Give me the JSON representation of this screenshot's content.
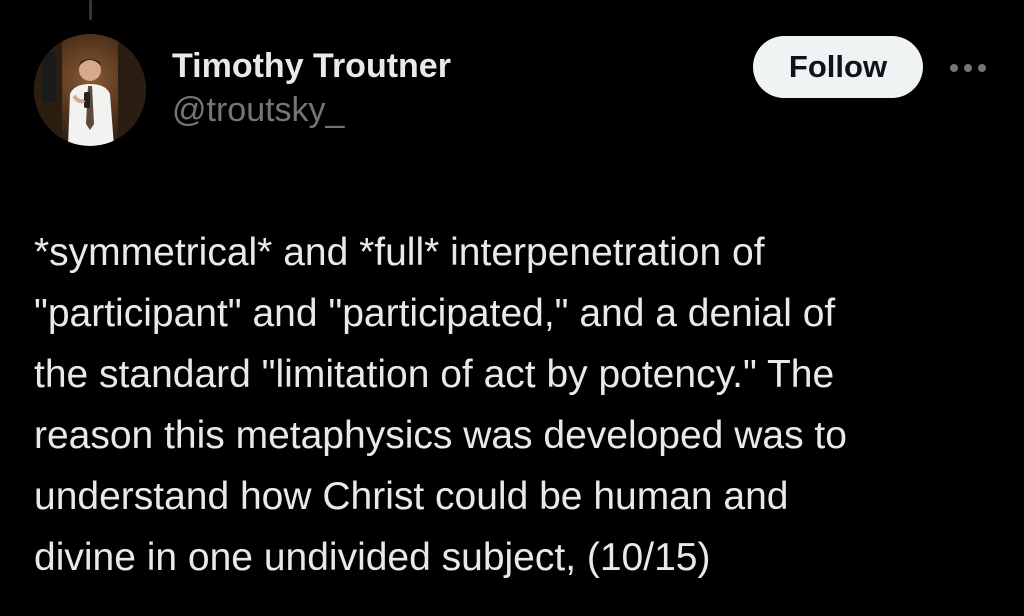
{
  "tweet": {
    "author": {
      "display_name": "Timothy Troutner",
      "handle": "@troutsky_",
      "avatar_icon": "profile-photo"
    },
    "follow_label": "Follow",
    "more_icon": "more-horizontal-icon",
    "text_lines": [
      "*symmetrical* and *full* interpenetration of",
      "\"participant\" and \"participated,\" and a denial of",
      "the standard \"limitation of act by potency.\" The",
      "reason this metaphysics was developed was to",
      "understand how Christ could be human and",
      "divine in one undivided subject, (10/15)"
    ]
  },
  "colors": {
    "background": "#000000",
    "primary_text": "#e7e9ea",
    "secondary_text": "#71767b",
    "follow_bg": "#eff3f4",
    "follow_text": "#0f1419"
  }
}
